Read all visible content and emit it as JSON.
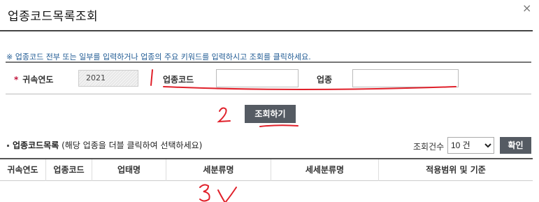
{
  "dialog": {
    "title": "업종코드목록조회",
    "close_icon": "×"
  },
  "notice": "※ 업종코드 전부 또는 일부를 입력하거나 업종의 주요 키워드를 입력하시고 조회를 클릭하세요.",
  "search": {
    "required_mark": "*",
    "year_label": "귀속연도",
    "year_value": "2021",
    "code_label": "업종코드",
    "code_value": "",
    "name_label": "업종",
    "name_value": "",
    "search_button": "조회하기"
  },
  "list": {
    "title": "업종코드목록",
    "hint": "(해당 업종을 더블 클릭하여 선택하세요)",
    "count_label": "조회건수",
    "count_options": [
      "10 건"
    ],
    "count_selected": "10 건",
    "confirm_button": "확인",
    "columns": [
      "귀속연도",
      "업종코드",
      "업태명",
      "세분류명",
      "세세분류명",
      "적용범위 및 기준"
    ]
  },
  "annotations": {
    "color": "#e0202a",
    "marks": [
      "1",
      "2",
      "3",
      "✓"
    ]
  }
}
